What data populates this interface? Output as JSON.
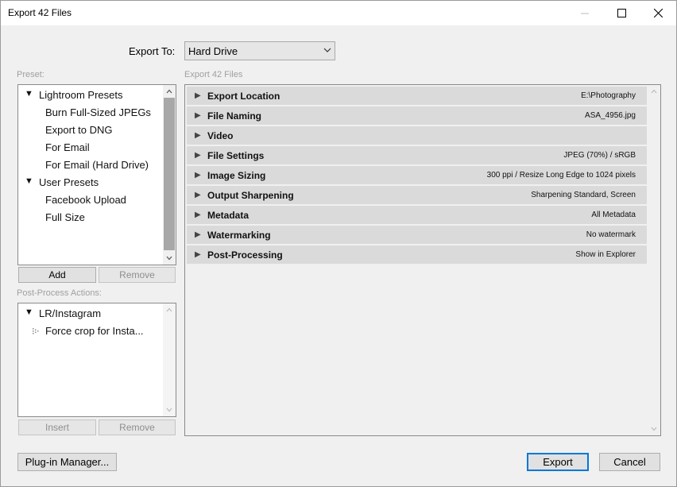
{
  "window": {
    "title": "Export 42 Files"
  },
  "export_to": {
    "label": "Export To:",
    "value": "Hard Drive"
  },
  "preset": {
    "label": "Preset:",
    "groups": [
      {
        "name": "Lightroom Presets",
        "items": [
          "Burn Full-Sized JPEGs",
          "Export to DNG",
          "For Email",
          "For Email (Hard Drive)"
        ]
      },
      {
        "name": "User Presets",
        "items": [
          "Facebook Upload",
          "Full Size"
        ]
      }
    ],
    "add_label": "Add",
    "remove_label": "Remove"
  },
  "post_process": {
    "label": "Post-Process Actions:",
    "group": "LR/Instagram",
    "item": "Force crop for Insta...",
    "insert_label": "Insert",
    "remove_label": "Remove"
  },
  "export_panel": {
    "label": "Export 42 Files",
    "sections": [
      {
        "title": "Export Location",
        "summary": "E:\\Photography"
      },
      {
        "title": "File Naming",
        "summary": "ASA_4956.jpg"
      },
      {
        "title": "Video",
        "summary": ""
      },
      {
        "title": "File Settings",
        "summary": "JPEG (70%) / sRGB"
      },
      {
        "title": "Image Sizing",
        "summary": "300 ppi / Resize Long Edge to 1024 pixels"
      },
      {
        "title": "Output Sharpening",
        "summary": "Sharpening Standard, Screen"
      },
      {
        "title": "Metadata",
        "summary": "All Metadata"
      },
      {
        "title": "Watermarking",
        "summary": "No watermark"
      },
      {
        "title": "Post-Processing",
        "summary": "Show in Explorer"
      }
    ]
  },
  "footer": {
    "plugin_manager_label": "Plug-in Manager...",
    "export_label": "Export",
    "cancel_label": "Cancel"
  },
  "colors": {
    "accent": "#0078d7",
    "section_bar": "#dadada",
    "panel_bg": "#f0f0f0"
  }
}
